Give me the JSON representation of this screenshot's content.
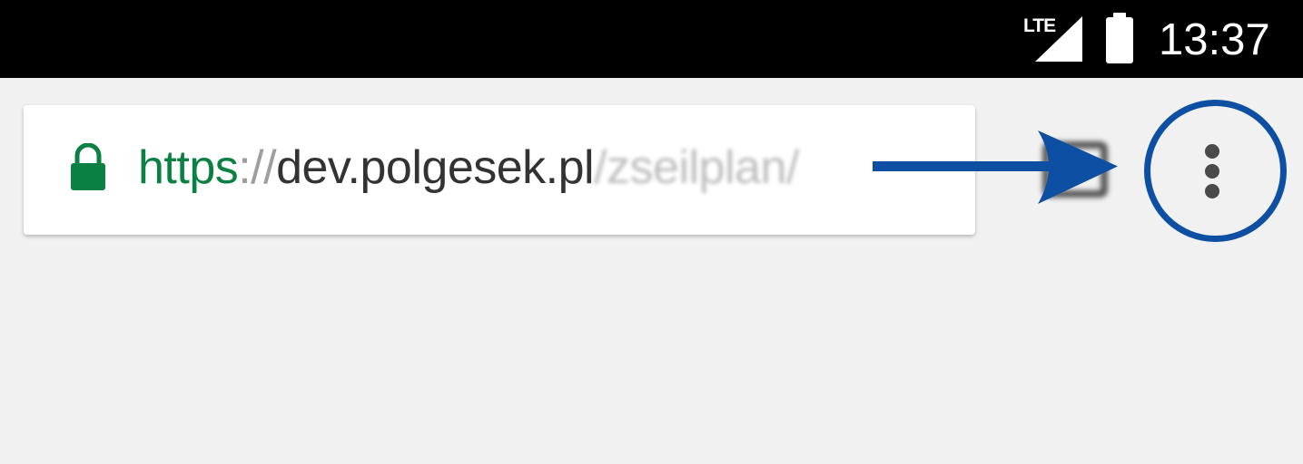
{
  "status_bar": {
    "network_label": "LTE",
    "time": "13:37",
    "icons": [
      "signal-icon",
      "battery-icon"
    ]
  },
  "omnibox": {
    "lock_icon": "lock-icon",
    "url_scheme": "https",
    "url_separator": "://",
    "url_host": "dev.polgesek.pl",
    "url_path": "/zseilplan/"
  },
  "toolbar": {
    "tabs_icon": "tab-switcher-icon",
    "menu_icon": "more-vertical-icon"
  },
  "annotation": {
    "target": "menu-button",
    "color": "#0d4fa3"
  },
  "colors": {
    "secure_green": "#0b8043",
    "annotation_blue": "#0d4fa3",
    "background": "#f1f1f1"
  }
}
